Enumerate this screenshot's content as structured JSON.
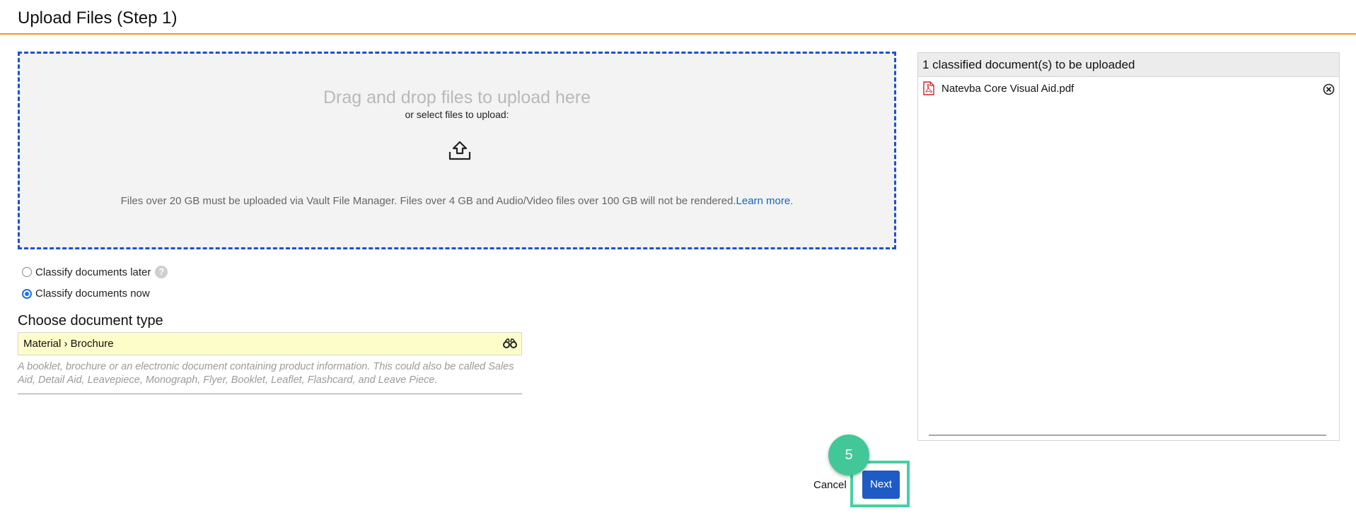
{
  "header": {
    "title": "Upload Files (Step 1)"
  },
  "dropzone": {
    "title": "Drag and drop files to upload here",
    "subtitle": "or select files to upload:",
    "upload_icon": "upload-tray-icon",
    "note": "Files over 20 GB must be uploaded via Vault File Manager. Files over 4 GB and Audio/Video files over 100 GB will not be rendered.",
    "learn_more": "Learn more",
    "note_end": "."
  },
  "classify": {
    "options": [
      {
        "label": "Classify documents later",
        "checked": false
      },
      {
        "label": "Classify documents now",
        "checked": true
      }
    ],
    "help_icon": "question-circle-icon"
  },
  "doc_type": {
    "label": "Choose document type",
    "value": "Material › Brochure",
    "lookup_icon": "binoculars-icon",
    "description": "A booklet, brochure or an electronic document containing product information. This could also be called Sales Aid, Detail Aid, Leavepiece, Monograph, Flyer, Booklet, Leaflet, Flashcard, and Leave Piece."
  },
  "panel": {
    "header": "1 classified document(s) to be uploaded",
    "files": [
      {
        "name": "Natevba Core Visual Aid.pdf",
        "icon": "pdf-file-icon",
        "remove_icon": "close-circle-icon"
      }
    ]
  },
  "actions": {
    "cancel": "Cancel",
    "next": "Next"
  },
  "tutorial": {
    "step": "5"
  },
  "colors": {
    "accent_line": "#f29527",
    "dropzone_border": "#1f4fd1",
    "primary_button": "#1f5bc4",
    "highlight": "#45d0a3",
    "field_bg": "#fdfdc9"
  }
}
